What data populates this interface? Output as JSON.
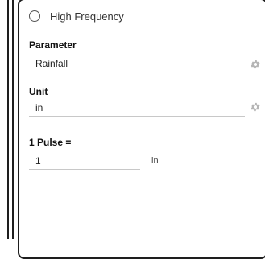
{
  "frequency_option": {
    "label": "High Frequency",
    "selected": false
  },
  "parameter": {
    "label": "Parameter",
    "value": "Rainfall",
    "settings_icon": "gear-icon"
  },
  "unit": {
    "label": "Unit",
    "value": "in",
    "settings_icon": "gear-icon"
  },
  "pulse": {
    "label": "1 Pulse =",
    "value": "1",
    "unit": "in"
  },
  "colors": {
    "border": "#1e1e1e",
    "text": "#222222",
    "icon": "#b5b5b5",
    "field_line": "#c8c8c8"
  }
}
